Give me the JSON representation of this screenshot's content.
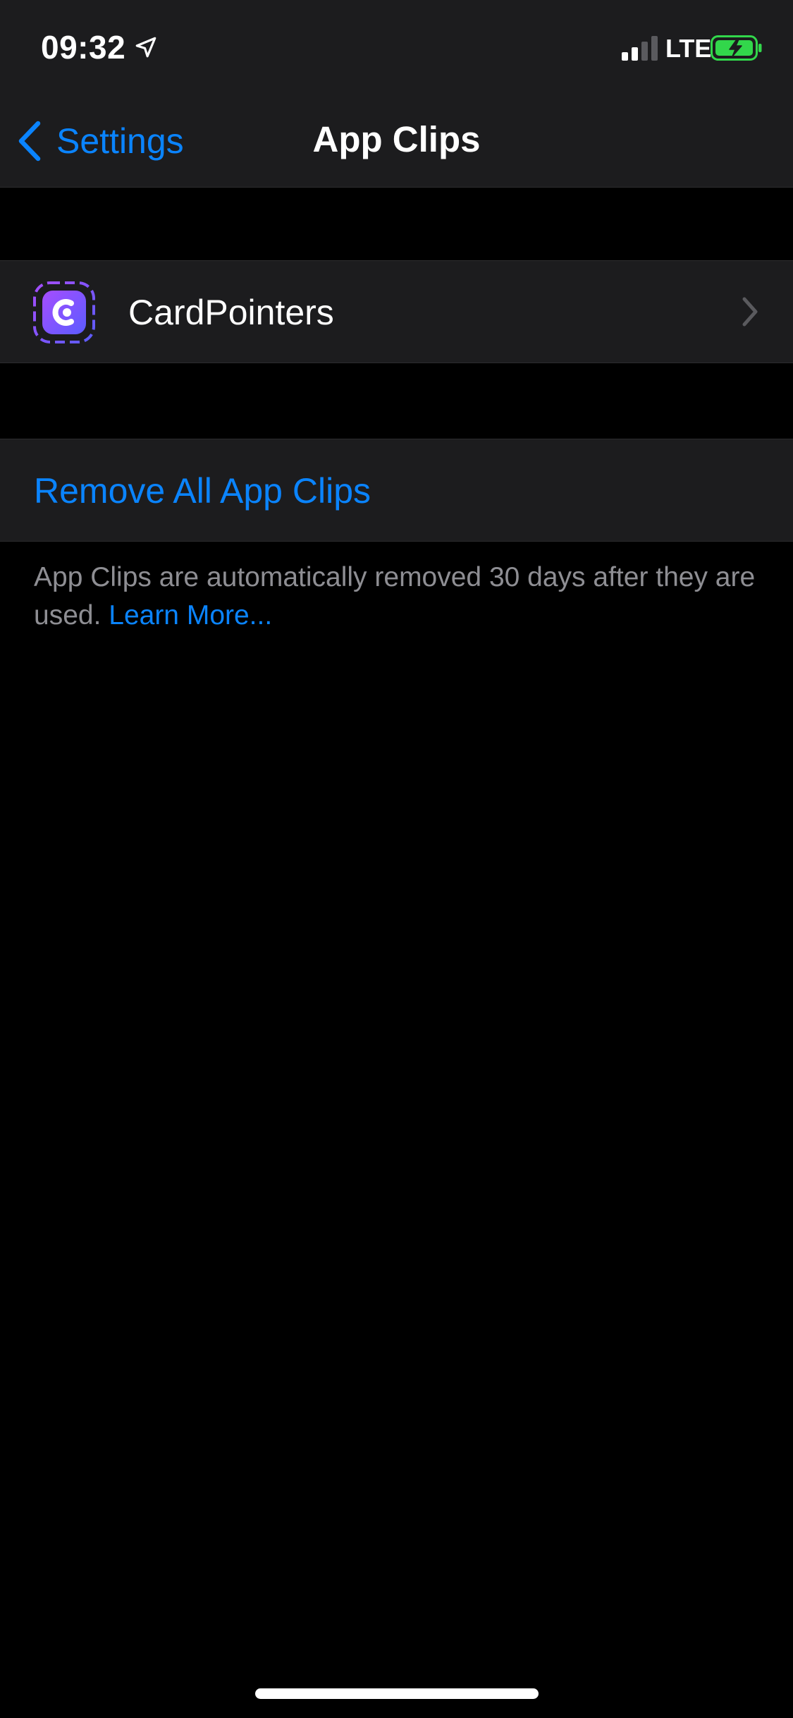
{
  "status_bar": {
    "time": "09:32",
    "network": "LTE",
    "location_icon": "location-arrow-icon",
    "signal_icon": "cellular-signal-icon",
    "battery_icon": "battery-charging-icon",
    "signal_bars_active": 2,
    "signal_bars_total": 4,
    "battery_color": "#32d74b"
  },
  "nav": {
    "back_label": "Settings",
    "back_icon": "chevron-left-icon",
    "title": "App Clips"
  },
  "app_clips": [
    {
      "name": "CardPointers",
      "icon": "cardpointers-app-icon",
      "disclosure_icon": "chevron-right-icon"
    }
  ],
  "actions": {
    "remove_all_label": "Remove All App Clips"
  },
  "footer": {
    "note": "App Clips are automatically removed 30 days after they are used.",
    "link_label": "Learn More..."
  },
  "colors": {
    "accent": "#0a84ff",
    "background": "#000000",
    "cell_background": "#1c1c1e",
    "secondary_text": "#8e8e93",
    "app_icon_gradient_start": "#a64dff",
    "app_icon_gradient_end": "#5b5cff"
  }
}
